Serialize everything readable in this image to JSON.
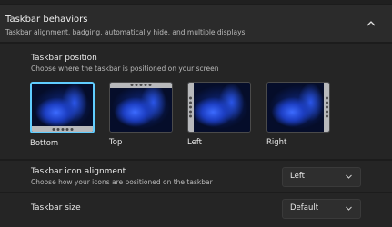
{
  "section": {
    "title": "Taskbar behaviors",
    "subtitle": "Taskbar alignment, badging, automatically hide, and multiple displays",
    "expanded": true
  },
  "position": {
    "title": "Taskbar position",
    "subtitle": "Choose where the taskbar is positioned on your screen",
    "options": [
      {
        "label": "Bottom",
        "selected": true
      },
      {
        "label": "Top",
        "selected": false
      },
      {
        "label": "Left",
        "selected": false
      },
      {
        "label": "Right",
        "selected": false
      }
    ]
  },
  "alignment": {
    "title": "Taskbar icon alignment",
    "subtitle": "Choose how your icons are positioned on the taskbar",
    "value": "Left"
  },
  "size": {
    "title": "Taskbar size",
    "value": "Default"
  },
  "colors": {
    "accent": "#60cdff",
    "background": "#1c1c1c",
    "card": "#252525"
  }
}
